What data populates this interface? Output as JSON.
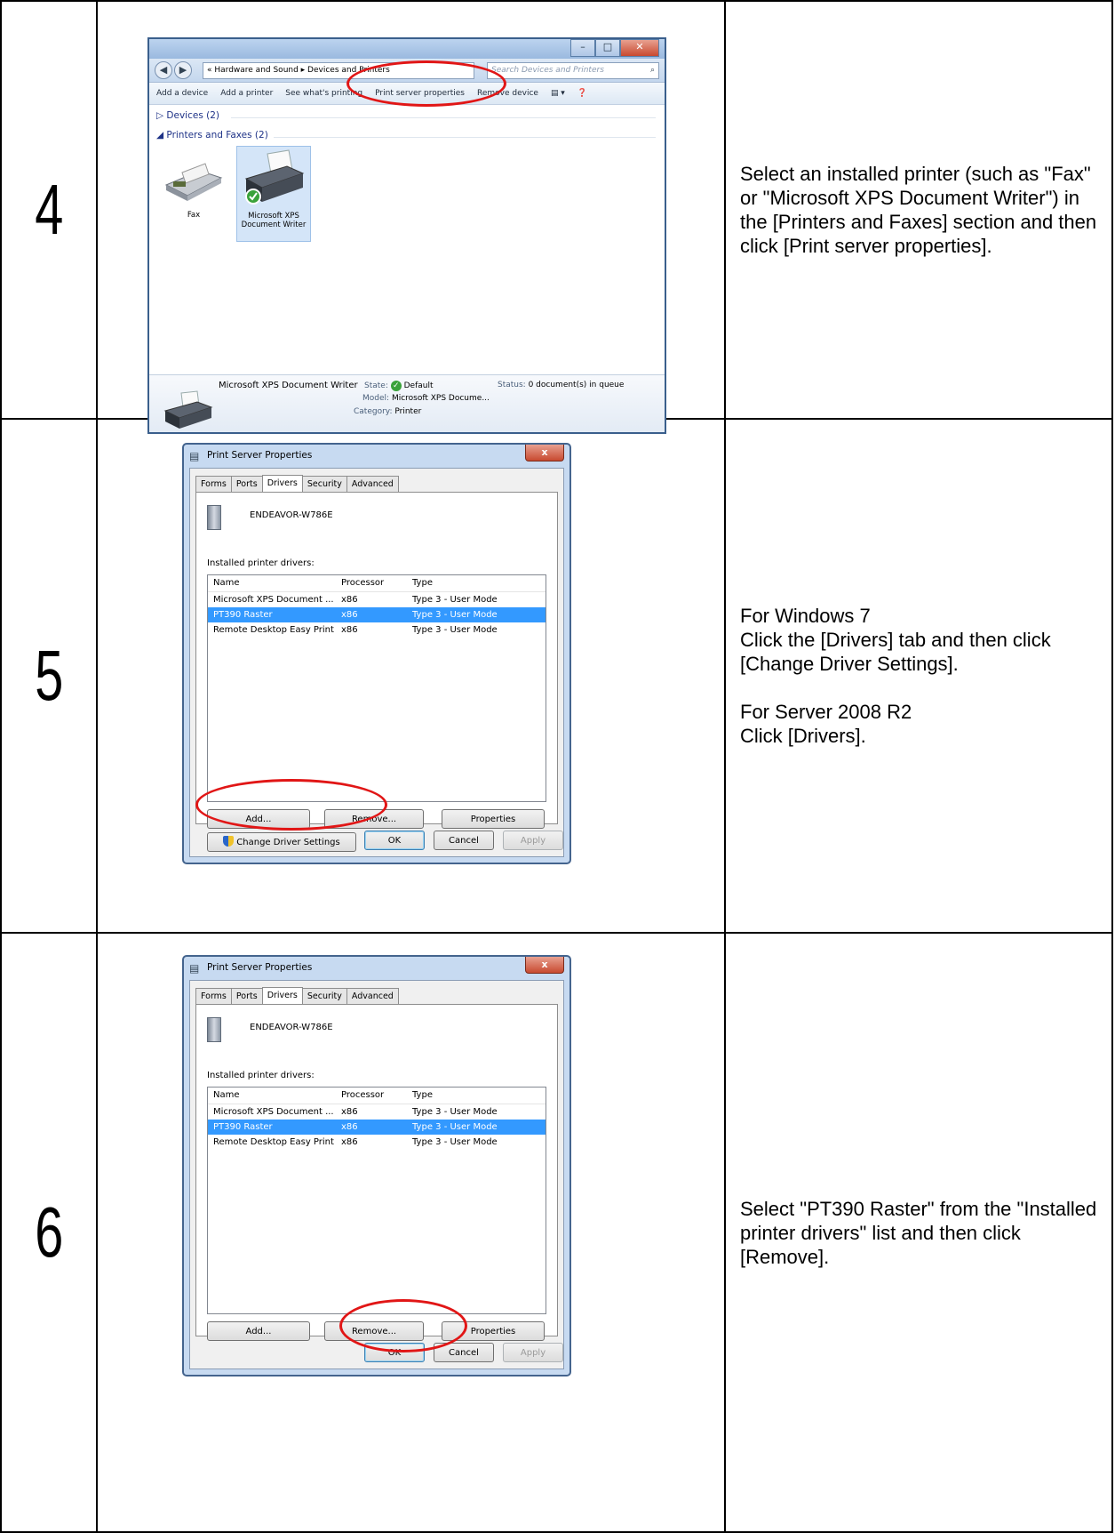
{
  "steps": [
    {
      "number": "4",
      "description": [
        "Select an installed printer (such as \"Fax\" or \"Microsoft XPS Document Writer\") in the [Printers and Faxes] section and then click [Print server properties]."
      ]
    },
    {
      "number": "5",
      "description": [
        "For Windows 7",
        "Click the [Drivers] tab and then click [Change Driver Settings].",
        "",
        "For Server 2008 R2",
        "Click [Drivers]."
      ]
    },
    {
      "number": "6",
      "description": [
        "Select \"PT390 Raster\" from the \"Installed printer drivers\" list and then click [Remove]."
      ]
    }
  ],
  "explorer": {
    "address": "« Hardware and Sound ▸ Devices and Printers",
    "search_placeholder": "Search Devices and Printers",
    "commands": [
      "Add a device",
      "Add a printer",
      "See what's printing",
      "Print server properties",
      "Remove device"
    ],
    "devices_header": "Devices (2)",
    "printers_header": "Printers and Faxes (2)",
    "printer_fax": "Fax",
    "printer_xps": "Microsoft XPS Document Writer",
    "status": {
      "name": "Microsoft XPS Document Writer",
      "state_label": "State:",
      "state_value": "Default",
      "model_label": "Model:",
      "model_value": "Microsoft XPS Docume...",
      "category_label": "Category:",
      "category_value": "Printer",
      "status_label": "Status:",
      "status_value": "0 document(s) in queue"
    }
  },
  "dialog": {
    "title": "Print Server Properties",
    "close_label": "x",
    "tabs": [
      "Forms",
      "Ports",
      "Drivers",
      "Security",
      "Advanced"
    ],
    "server_name": "ENDEAVOR-W786E",
    "installed_label": "Installed printer drivers:",
    "columns": [
      "Name",
      "Processor",
      "Type"
    ],
    "rows": [
      [
        "Microsoft XPS Document ...",
        "x86",
        "Type 3 - User Mode"
      ],
      [
        "PT390 Raster",
        "x86",
        "Type 3 - User Mode"
      ],
      [
        "Remote Desktop Easy Print",
        "x86",
        "Type 3 - User Mode"
      ]
    ],
    "add_label": "Add...",
    "remove_label": "Remove...",
    "properties_label": "Properties",
    "change_settings_label": "Change Driver Settings",
    "ok_label": "OK",
    "cancel_label": "Cancel",
    "apply_label": "Apply"
  },
  "colors": {
    "highlight": "#e11616",
    "selection": "#3399ff"
  }
}
